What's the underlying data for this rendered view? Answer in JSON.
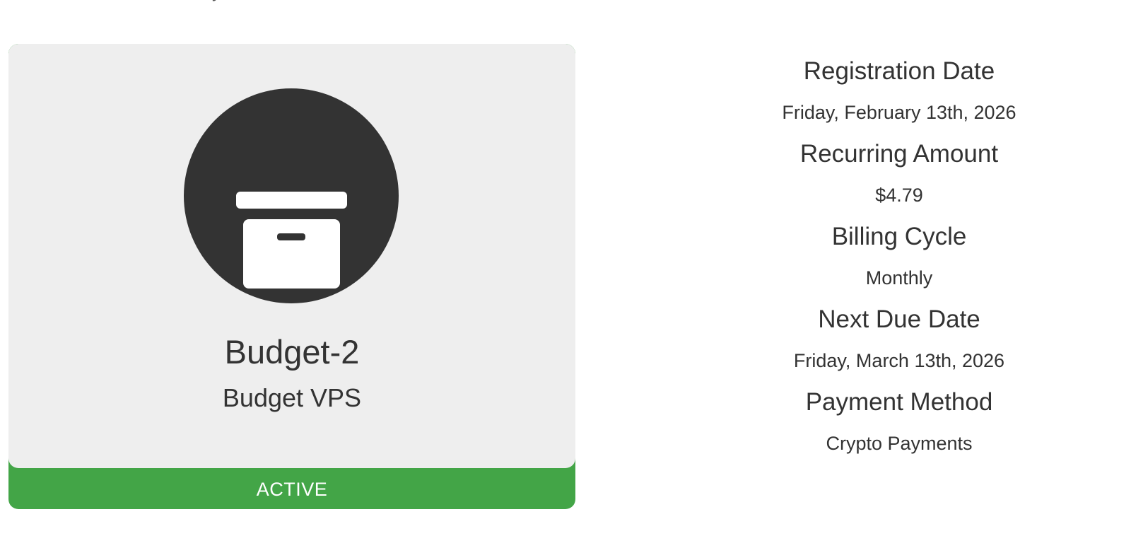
{
  "service": {
    "cut_heading": "y",
    "name": "Budget-2",
    "group": "Budget VPS",
    "status": "ACTIVE",
    "icon": "archive-box-icon",
    "colors": {
      "panel": "#eeeeee",
      "icon_circle": "#333333",
      "status_active": "#43a547"
    }
  },
  "details": [
    {
      "label": "Registration Date",
      "value": "Friday, February 13th, 2026"
    },
    {
      "label": "Recurring Amount",
      "value": "$4.79"
    },
    {
      "label": "Billing Cycle",
      "value": "Monthly"
    },
    {
      "label": "Next Due Date",
      "value": "Friday, March 13th, 2026"
    },
    {
      "label": "Payment Method",
      "value": "Crypto Payments"
    }
  ]
}
